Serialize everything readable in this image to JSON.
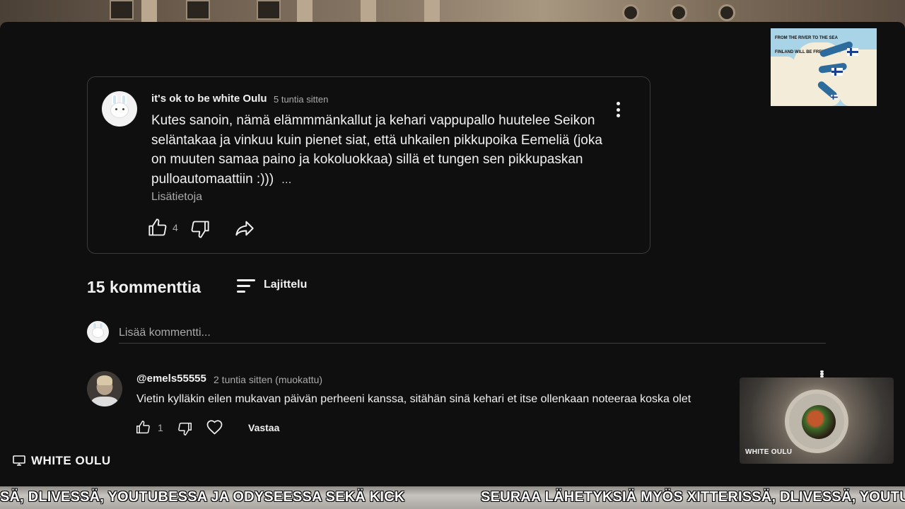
{
  "pinned_comment": {
    "author": "it's ok to be white Oulu",
    "time": "5 tuntia sitten",
    "text": "Kutes sanoin, nämä elämmmänkallut ja kehari vappupallo huutelee Seikon seläntakaa ja vinkuu kuin pienet siat, että uhkailen pikkupoika Eemeliä (joka on muuten samaa paino ja kokoluokkaa) sillä et tungen sen pikkupaskan pulloautomaattiin :)))",
    "ellipsis": "…",
    "read_more": "Lisätietoja",
    "like_count": "4"
  },
  "comments_header": {
    "count_label": "15 kommenttia",
    "sort_label": "Lajittelu"
  },
  "add_comment": {
    "placeholder": "Lisää kommentti..."
  },
  "comment": {
    "author": "@emels55555",
    "time": "2 tuntia sitten (muokattu)",
    "text": "Vietin kylläkin eilen mukavan päivän perheeni kanssa, sitähän sinä kehari et itse ollenkaan noteeraa koska olet",
    "like_count": "1",
    "reply_label": "Vastaa"
  },
  "overlay": {
    "map_text_1": "FROM THE RIVER TO THE SEA",
    "map_text_2": "FINLAND WILL BE FREE",
    "cam_label": "WHITE OULU",
    "streamer_label": "WHITE OULU",
    "ticker_left": "SÄ, DLIVESSÄ, YOUTUBESSA JA ODYSEESSA SEKÄ KICK",
    "ticker_right": "SEURAA LÄHETYKSIÄ MYÖS XITTERISSÄ, DLIVESSÄ, YOUTUBESSA JA"
  },
  "colors": {
    "background": "#0f0f0f",
    "text_primary": "#f1f1f1",
    "text_secondary": "#aaaaaa",
    "border": "#3a3a3a"
  },
  "icons": [
    "kebab-menu-icon",
    "thumbs-up-icon",
    "thumbs-down-icon",
    "share-icon",
    "sort-icon",
    "heart-icon",
    "monitor-icon"
  ]
}
